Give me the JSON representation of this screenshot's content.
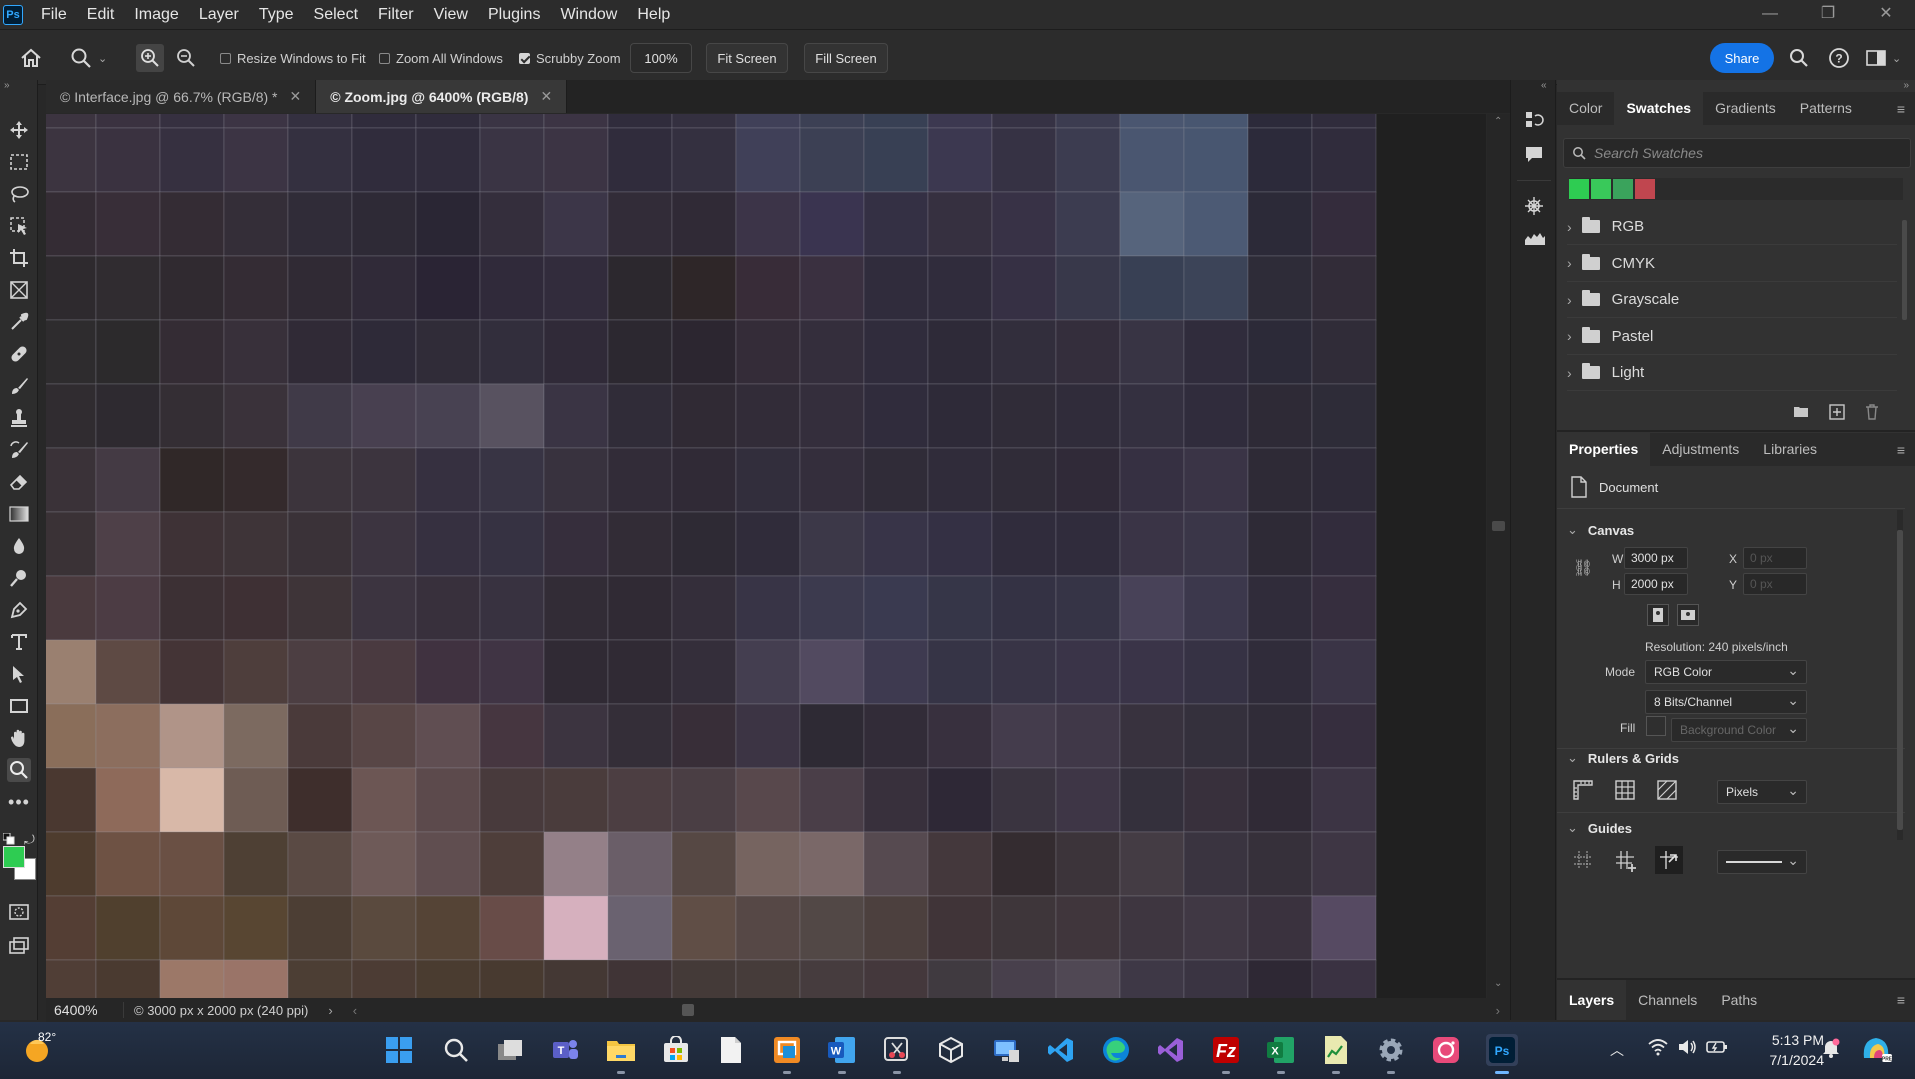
{
  "menubar": {
    "logo": "Ps",
    "items": [
      "File",
      "Edit",
      "Image",
      "Layer",
      "Type",
      "Select",
      "Filter",
      "View",
      "Plugins",
      "Window",
      "Help"
    ],
    "window_controls": [
      "minimize-icon",
      "restore-icon",
      "close-icon"
    ]
  },
  "options_bar": {
    "resize_windows": {
      "label": "Resize Windows to Fit",
      "checked": false
    },
    "zoom_all_windows": {
      "label": "Zoom All Windows",
      "checked": false
    },
    "scrubby_zoom": {
      "label": "Scrubby Zoom",
      "checked": true
    },
    "zoom_value": "100%",
    "fit_screen": "Fit Screen",
    "fill_screen": "Fill Screen",
    "share": "Share"
  },
  "document_tabs": [
    {
      "label": "© Interface.jpg @ 66.7% (RGB/8) *",
      "active": false
    },
    {
      "label": "© Zoom.jpg @ 6400% (RGB/8)",
      "active": true
    }
  ],
  "status": {
    "zoom": "6400%",
    "doc_info": "© 3000 px x 2000 px (240 ppi)"
  },
  "swatches_panel": {
    "tabs": [
      "Color",
      "Swatches",
      "Gradients",
      "Patterns"
    ],
    "active_tab": "Swatches",
    "search_placeholder": "Search Swatches",
    "recent": [
      "#2ecc52",
      "#39c95a",
      "#3aa35c",
      "#c0464f"
    ],
    "folders": [
      "RGB",
      "CMYK",
      "Grayscale",
      "Pastel",
      "Light"
    ]
  },
  "properties_panel": {
    "tabs": [
      "Properties",
      "Adjustments",
      "Libraries"
    ],
    "active_tab": "Properties",
    "kind": "Document",
    "canvas": {
      "title": "Canvas",
      "w_label": "W",
      "w": "3000 px",
      "h_label": "H",
      "h": "2000 px",
      "x_label": "X",
      "x": "0 px",
      "y_label": "Y",
      "y": "0 px",
      "resolution": "Resolution: 240 pixels/inch",
      "mode_label": "Mode",
      "mode": "RGB Color",
      "depth": "8 Bits/Channel",
      "fill_label": "Fill",
      "fill": "Background Color"
    },
    "rulers": {
      "title": "Rulers & Grids",
      "units": "Pixels"
    },
    "guides": {
      "title": "Guides"
    }
  },
  "layers_panel": {
    "tabs": [
      "Layers",
      "Channels",
      "Paths"
    ],
    "active_tab": "Layers"
  },
  "colors": {
    "foreground": "#2ecc52",
    "background": "#ffffff",
    "accent": "#1473e6"
  },
  "pixel_rows": [
    "3c3440 3a3240 363040 3c3444 343040 302c3c 302c3c 3a3444 3c3444 302c3c 343040 404058 3c4054 384054 3c3850 363244 3c3c50 4a5670 485670 2c2a3a 302c3c",
    "3c3440 3a3240 363040 3c3444 343040 302c3c 302c3c 3a3444 3c3444 302c3c 343040 404058 3c4054 384054 3c3850 363244 3c3c50 4a5670 485670 2c2a3a 302c3c",
    "342c34 382e38 342c34 342e38 302c38 2e2a36 2a2634 342e3c 3c3648 322c38 302a36 3c3448 3a3450 343044 363040 383246 3c3c50 56647c 4c5a74 2c2a38 342c3c",
    "2e2a2e 302c30 302a30 342c34 302a34 302a38 2a2434 302a3a 322c3c 2c282e 2e2628 382c38 3a3040 302c3c 302c3c 363044 38384a 384054 3c4458 2e2c38 322c38",
    "2e2c2e 2c2a2c 342c34 38303a 302a36 2e2a38 302c38 322e3c 302a38 2c2830 2c2630 342c38 342e3c 302c3c 2e2a38 322e3c 342e3c 383444 302c3c 2c2a38 302c38",
    "302c30 2e2a30 342e34 3a323a 403a48 484050 484252 585260 3a3444 302c38 302a34 322c38 342e3c 302c3c 2e2a38 302c38 302c3a 343040 302c3c 2e2a36 2e2c38",
    "3a3238 443a44 302828 342a2c 3c343c 3c343e 363040 383444 38323e 322c38 302a36 322e3c 342e3c 302c38 302c3a 302c38 302a38 363042 3a3446 2e2a36 2e2a38",
    "3a3236 4e4048 3e3236 3e3438 3a3238 3c3440 363040 363242 362e3c 322c36 2e2a34 302c3a 3c3848 383448 343044 302c3c 302c3c 3a3446 3a3648 2e2a36 322c3c",
    "4a3a3e 4c3c44 3c3034 3e3034 3e3438 3c3440 38303c 383240 322c36 302a34 342e3a 383446 3c3a4e 3a3a50 363648 343244 363446 484258 3c384c 302c3a 362e3e",
    "9a8070 5e4a44 443436 4e3e3c 4c3e42 4a3a40 403240 403444 302a34 302a34 342e3a 443e50 524a60 3e3a50 363446 383446 3a3448 3a3448 363244 302c3a 3a3446",
    "8a6e5a 8c6e5e b09488 7c6a60 4a3a3a 584646 604e52 463640 3c3440 342e38 382e38 3c3444 2e2a34 322c38 38303e 443c4c 403848 38323e 34303c 302c38 362e3e",
    "4a3830 8e6a5a d8b8a8 6e5c54 3e2e2c 6c5654 5c4a4c 483a3c 4a3c3c 4c3e42 4a3e44 58484c 4a3e48 38303c 2e2836 3a3440 3e3646 34303c 38303c 302a36 3c3444",
    "4e3c2e 6e5244 6a5044 4e4034 5a4a44 6e5a58 604e50 4e3e3a 948088 6a5e68 564844 766460 7a6868 564a50 44383c 342c30 3c343a 443c44 3a3440 36303a 3e3644",
    "543e34 50402e 5e4838 584632 4c3e34 5a4a3e 554436 684c48 d6b0be 6a6270 604e46 564846 524846 4c403e 403438 3e363a 40363c 3e3640 403844 3a323e 564a62",
    "503e36 4a3a30 9c7868 9a7468 4c3e34 4c3c34 4a3c30 483a30 443834 403436 443a38 463c3a 463c3e 44383c 403a40 48404c 504854 3e3846 3a3442 2e2834 3a3242"
  ]
}
